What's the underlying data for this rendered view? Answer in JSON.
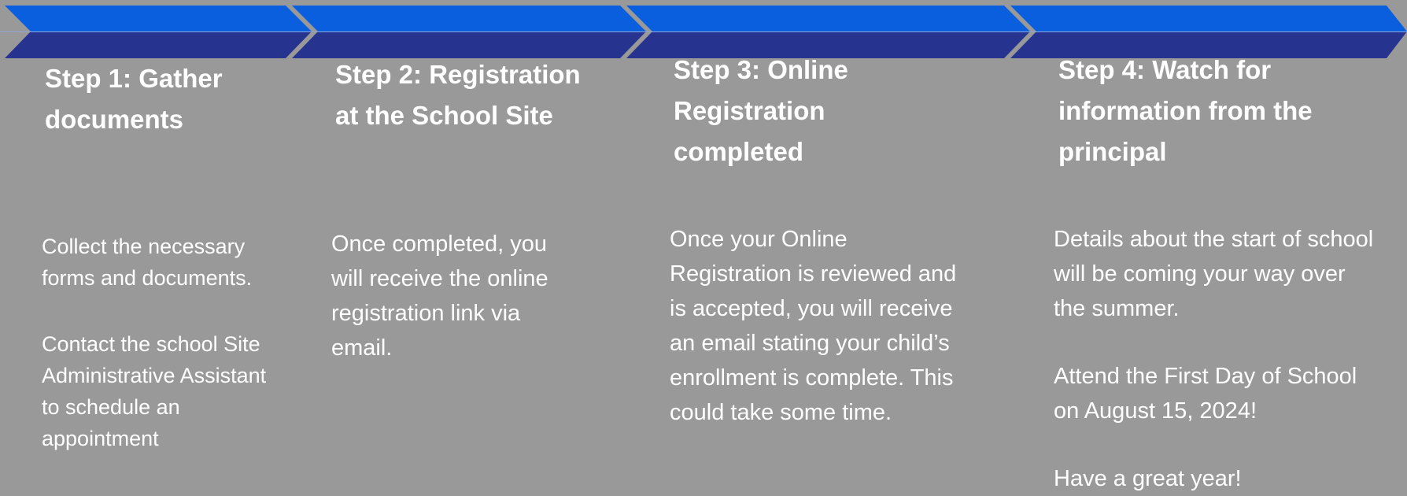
{
  "colors": {
    "background": "#999999",
    "chevron_top": "#0a5fde",
    "chevron_bottom": "#27348f",
    "text": "#ffffff"
  },
  "steps": [
    {
      "title": "Step 1: Gather documents",
      "paragraphs": [
        "Collect the necessary forms and documents.",
        "Contact the school Site Administrative Assistant  to schedule an  appointment"
      ]
    },
    {
      "title": "Step 2: Registration at the School Site",
      "paragraphs": [
        "Once completed, you will receive the online registration link via email."
      ]
    },
    {
      "title": "Step 3: Online Registration completed",
      "paragraphs": [
        "Once your Online Registration is reviewed and is accepted, you will receive an email stating your child’s enrollment is complete. This could take some time."
      ]
    },
    {
      "title": "Step 4: Watch for information from the principal",
      "paragraphs": [
        "Details about the start of school will be coming your way over the summer.",
        "Attend the First Day of School on August 15, 2024!",
        "Have a great year!"
      ]
    }
  ]
}
